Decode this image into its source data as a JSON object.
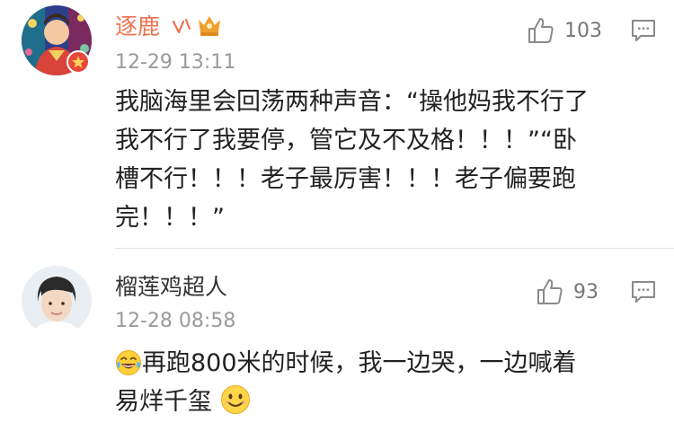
{
  "comments": [
    {
      "username": "逐鹿",
      "avatar": "portrait-avatar-colorful",
      "badges": [
        "level-v-icon",
        "crown-vip-icon",
        "red-verified-badge"
      ],
      "timestamp": "12-29 13:11",
      "likes": "103",
      "lines": [
        "我脑海里会回荡两种声音：“操他妈我不行了",
        "我不行了我要停，管它及不及格！！！”“卧",
        "槽不行！！！老子最厉害！！！老子偏要跑",
        "完！！！”"
      ]
    },
    {
      "username": "榴莲鸡超人",
      "avatar": "portrait-avatar-boy",
      "timestamp": "12-28 08:58",
      "likes": "93",
      "emoji_lead": "laughing-crying-emoji",
      "line1": "再跑800米的时候，我一边哭，一边喊着",
      "line2": "易烊千玺",
      "emoji_trail": "smile-emoji"
    }
  ],
  "colors": {
    "username_highlight": "#eb7350",
    "username_normal": "#333333",
    "timestamp": "#9a9a9a",
    "icon_gray": "#9a9a9a",
    "badge_red": "#e8483a",
    "crown_gold": "#f0a030"
  }
}
